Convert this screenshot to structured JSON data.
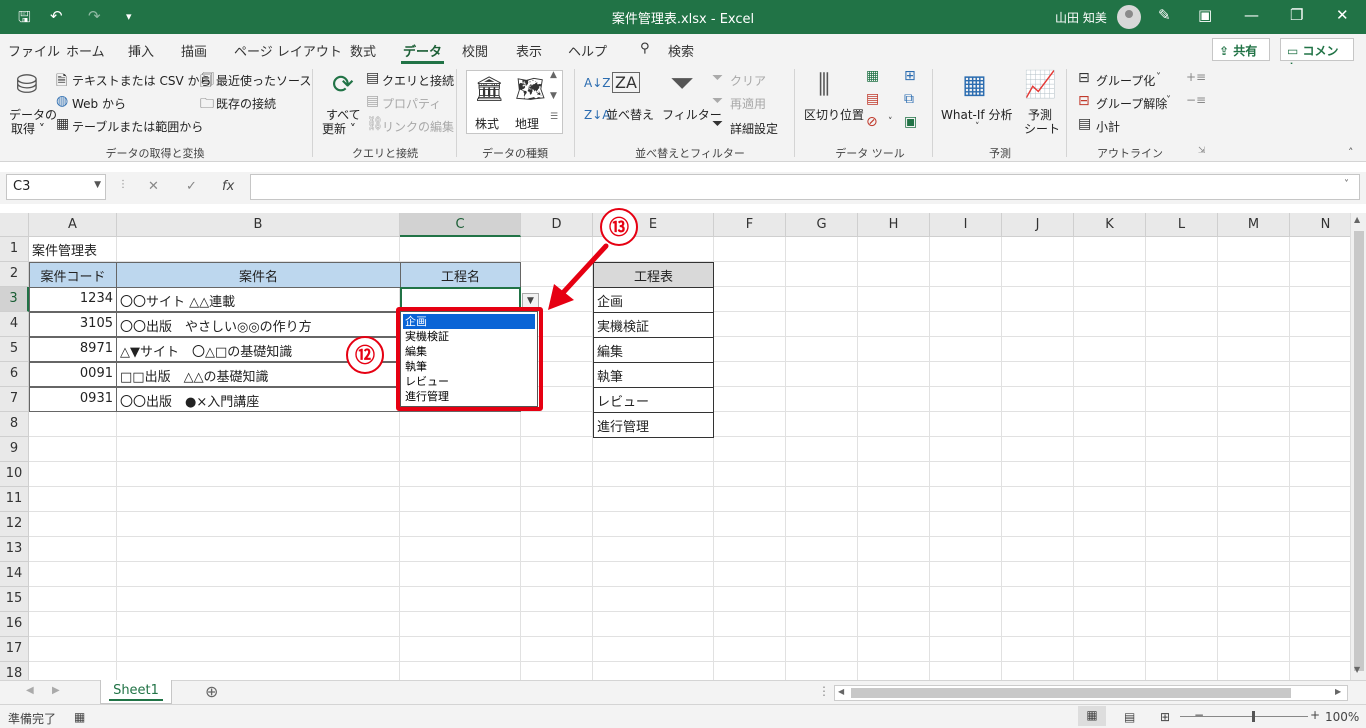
{
  "titlebar": {
    "title": "案件管理表.xlsx  -  Excel",
    "user": "山田 知美"
  },
  "menu": {
    "tabs": [
      "ファイル",
      "ホーム",
      "挿入",
      "描画",
      "ページ レイアウト",
      "数式",
      "データ",
      "校閲",
      "表示",
      "ヘルプ"
    ],
    "active_tab": "データ",
    "search": "検索",
    "share": "共有",
    "comment": "コメント"
  },
  "ribbon": {
    "get_data": {
      "big_label": "データの",
      "big_label2": "取得 ˅",
      "text_csv": "テキストまたは CSV から",
      "web": "Web から",
      "table_range": "テーブルまたは範囲から",
      "recent": "最近使ったソース",
      "existing": "既存の接続",
      "group": "データの取得と変換"
    },
    "queries": {
      "refresh_all": "すべて",
      "refresh_all2": "更新 ˅",
      "queries_conn": "クエリと接続",
      "properties": "プロパティ",
      "edit_links": "リンクの編集",
      "group": "クエリと接続"
    },
    "data_types": {
      "stocks": "株式",
      "geography": "地理",
      "group": "データの種類"
    },
    "sort_filter": {
      "sort": "並べ替え",
      "filter": "フィルター",
      "clear": "クリア",
      "reapply": "再適用",
      "advanced": "詳細設定",
      "group": "並べ替えとフィルター"
    },
    "data_tools": {
      "text_to_columns": "区切り位置",
      "group": "データ ツール"
    },
    "forecast": {
      "what_if": "What-If 分析",
      "forecast_sheet": "予測",
      "forecast_sheet2": "シート",
      "group": "予測"
    },
    "outline": {
      "group_btn": "グループ化",
      "ungroup": "グループ解除",
      "subtotal": "小計",
      "group": "アウトライン"
    }
  },
  "formula_bar": {
    "name_box": "C3",
    "formula": ""
  },
  "grid": {
    "columns": [
      "A",
      "B",
      "C",
      "D",
      "E",
      "F",
      "G",
      "H",
      "I",
      "J",
      "K",
      "L",
      "M",
      "N"
    ],
    "rows": [
      "1",
      "2",
      "3",
      "4",
      "5",
      "6",
      "7",
      "8",
      "9",
      "10",
      "11",
      "12",
      "13",
      "14",
      "15",
      "16",
      "17",
      "18"
    ],
    "title": "案件管理表",
    "table_headers": [
      "案件コード",
      "案件名",
      "工程名"
    ],
    "table_rows": [
      {
        "code": "1234",
        "name": "〇〇サイト △△連載"
      },
      {
        "code": "3105",
        "name": "〇〇出版　やさしい◎◎の作り方"
      },
      {
        "code": "8971",
        "name": "△▼サイト　〇△□の基礎知識"
      },
      {
        "code": "0091",
        "name": "□□出版　△△の基礎知識"
      },
      {
        "code": "0931",
        "name": "〇〇出版　●×入門講座"
      }
    ],
    "process_header": "工程表",
    "process_list": [
      "企画",
      "実機検証",
      "編集",
      "執筆",
      "レビュー",
      "進行管理"
    ]
  },
  "dropdown": {
    "options": [
      "企画",
      "実機検証",
      "編集",
      "執筆",
      "レビュー",
      "進行管理"
    ],
    "selected": "企画"
  },
  "annotations": {
    "badge_12": "⑫",
    "badge_13": "⑬"
  },
  "sheets": {
    "tabs": [
      "Sheet1"
    ]
  },
  "status": {
    "ready": "準備完了",
    "zoom": "100%"
  },
  "colors": {
    "excel_green": "#217346",
    "header_fill": "#bdd7ee",
    "highlight_red": "#e60012",
    "selection_blue": "#0a64d6"
  }
}
